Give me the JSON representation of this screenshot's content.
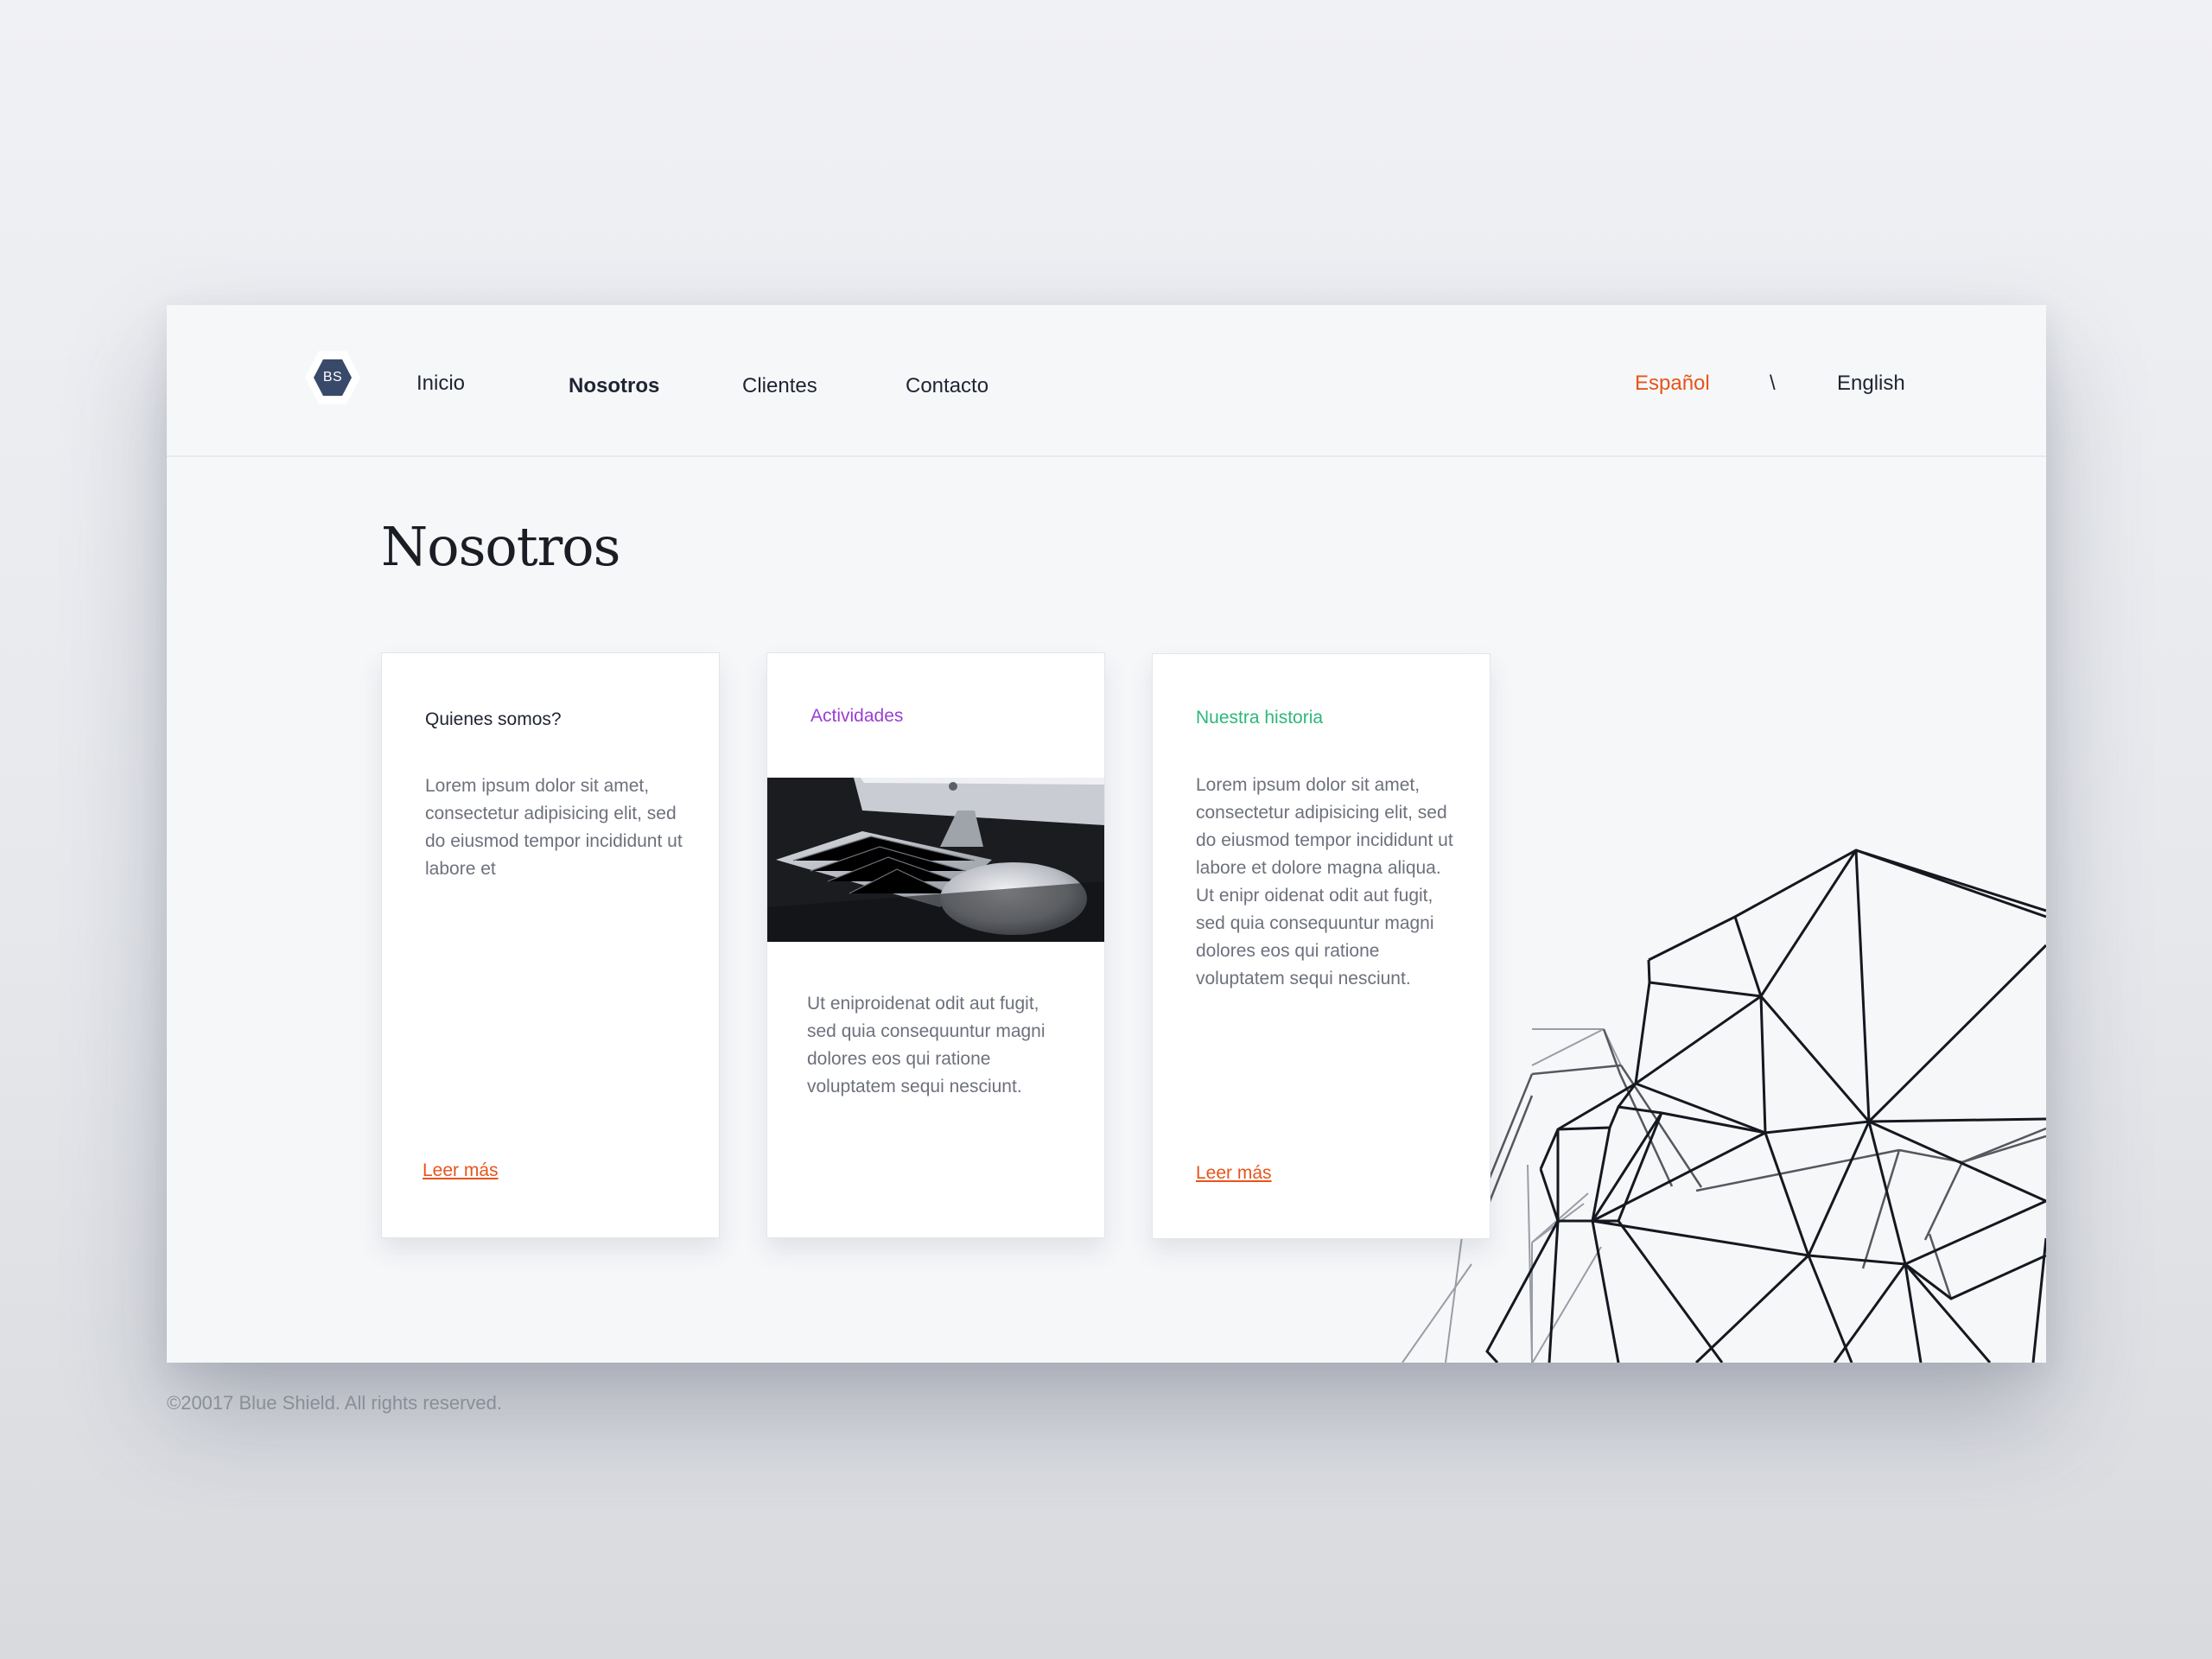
{
  "logo": {
    "text": "BS"
  },
  "nav": [
    {
      "label": "Inicio",
      "active": false
    },
    {
      "label": "Nosotros",
      "active": true
    },
    {
      "label": "Clientes",
      "active": false
    },
    {
      "label": "Contacto",
      "active": false
    }
  ],
  "language": {
    "current": "Español",
    "separator": "\\",
    "other": "English",
    "active_color": "#e8541b"
  },
  "page": {
    "title": "Nosotros"
  },
  "cards": [
    {
      "title": "Quienes somos?",
      "title_color": "#1f2433",
      "text": "Lorem ipsum dolor sit amet, consectetur adipisicing elit, sed do eiusmod tempor incididunt ut labore et",
      "link": "Leer más"
    },
    {
      "title": "Actividades",
      "title_color": "#9b3ed4",
      "image": "computer-keyboard-mouse-photo",
      "text": "Ut eniproidenat odit aut fugit, sed quia consequuntur magni dolores eos qui ratione voluptatem sequi nesciunt."
    },
    {
      "title": "Nuestra historia",
      "title_color": "#2eb77a",
      "text": "Lorem ipsum dolor sit amet, consectetur adipisicing elit, sed do eiusmod tempor incididunt ut labore et dolore magna aliqua. Ut enipr oidenat odit aut fugit, sed quia consequuntur magni dolores eos qui ratione voluptatem sequi nesciunt.",
      "link": "Leer más"
    }
  ],
  "footer": {
    "text": "©20017 Blue Shield. All rights reserved."
  }
}
